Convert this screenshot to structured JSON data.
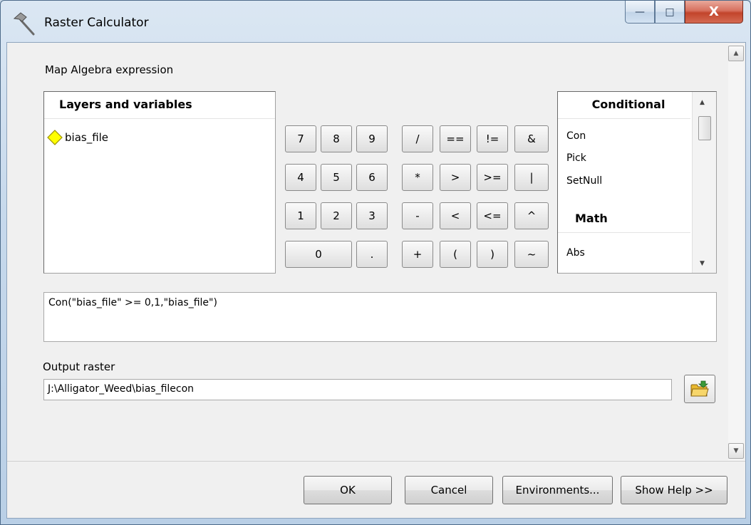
{
  "window": {
    "title": "Raster Calculator",
    "controls": {
      "minimize": "—",
      "maximize": "□",
      "close": "X"
    }
  },
  "expression_section": {
    "label": "Map Algebra expression"
  },
  "layers": {
    "header": "Layers and variables",
    "items": [
      {
        "label": "bias_file",
        "icon": "raster-layer-diamond-icon",
        "icon_color": "#ffff00"
      }
    ]
  },
  "keypad": {
    "row1": [
      "7",
      "8",
      "9",
      "/",
      "==",
      "!=",
      "&"
    ],
    "row2": [
      "4",
      "5",
      "6",
      "*",
      ">",
      ">=",
      "|"
    ],
    "row3": [
      "1",
      "2",
      "3",
      "-",
      "<",
      "<=",
      "^"
    ],
    "row4": [
      "0",
      ".",
      "+",
      "(",
      ")",
      "~"
    ]
  },
  "functions": {
    "conditional_header": "Conditional",
    "conditional_items": [
      "Con",
      "Pick",
      "SetNull"
    ],
    "math_header": "Math",
    "math_items": [
      "Abs"
    ]
  },
  "expression": {
    "value": "Con(\"bias_file\" >= 0,1,\"bias_file\")"
  },
  "output": {
    "label": "Output raster",
    "value": "J:\\Alligator_Weed\\bias_filecon",
    "browse_icon": "open-folder-icon"
  },
  "buttons": {
    "ok": "OK",
    "cancel": "Cancel",
    "environments": "Environments...",
    "show_help": "Show Help >>"
  },
  "colors": {
    "close_button": "#c2442b",
    "window_frame": "#c7d9ec",
    "dialog_background": "#f0f0f0"
  }
}
